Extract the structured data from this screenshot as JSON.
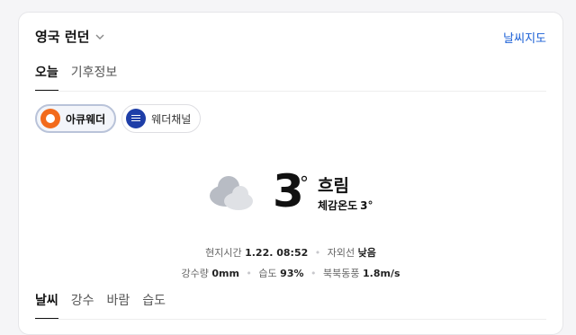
{
  "header": {
    "location": "영국 런던",
    "weather_map_link": "날씨지도"
  },
  "tabs": [
    {
      "label": "오늘",
      "active": true
    },
    {
      "label": "기후정보",
      "active": false
    }
  ],
  "providers": [
    {
      "label": "아큐웨더",
      "selected": true,
      "icon": "accuweather-logo"
    },
    {
      "label": "웨더채널",
      "selected": false,
      "icon": "weather-channel-logo"
    }
  ],
  "current": {
    "icon": "cloudy-icon",
    "temperature": "3",
    "degree_symbol": "°",
    "condition": "흐림",
    "feels_like_label": "체감온도",
    "feels_like_value": "3°"
  },
  "details": {
    "local_time_label": "현지시간",
    "local_time_value": "1.22. 08:52",
    "uv_label": "자외선",
    "uv_value": "낮음",
    "precip_label": "강수량",
    "precip_value": "0mm",
    "humidity_label": "습도",
    "humidity_value": "93%",
    "wind_label": "북북동풍",
    "wind_value": "1.8m/s"
  },
  "bottom_tabs": [
    {
      "label": "날씨",
      "active": true
    },
    {
      "label": "강수",
      "active": false
    },
    {
      "label": "바람",
      "active": false
    },
    {
      "label": "습도",
      "active": false
    }
  ]
}
